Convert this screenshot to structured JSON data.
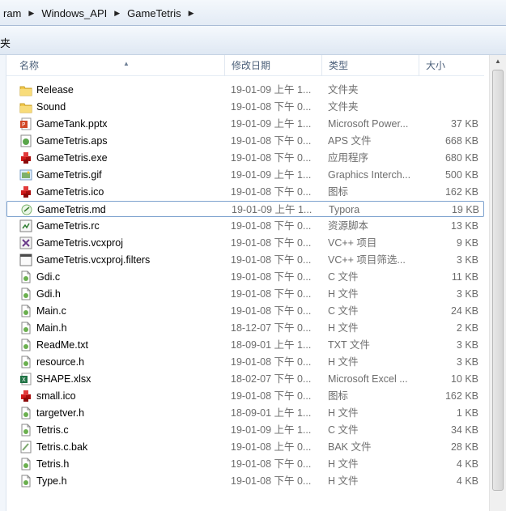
{
  "breadcrumb": [
    "ram",
    "Windows_API",
    "GameTetris"
  ],
  "toolbar": {
    "item_label": "夹"
  },
  "columns": {
    "name": "名称",
    "date": "修改日期",
    "type": "类型",
    "size": "大小"
  },
  "colors": {
    "selection_border": "#7da2ce",
    "header_text": "#4c607a",
    "meta_text": "#6d6d6d"
  },
  "files": [
    {
      "icon": "folder-icon",
      "name": "Release",
      "date": "19-01-09 上午 1...",
      "type": "文件夹",
      "size": ""
    },
    {
      "icon": "folder-icon",
      "name": "Sound",
      "date": "19-01-08 下午 0...",
      "type": "文件夹",
      "size": ""
    },
    {
      "icon": "pptx-icon",
      "name": "GameTank.pptx",
      "date": "19-01-09 上午 1...",
      "type": "Microsoft Power...",
      "size": "37 KB"
    },
    {
      "icon": "aps-icon",
      "name": "GameTetris.aps",
      "date": "19-01-08 下午 0...",
      "type": "APS 文件",
      "size": "668 KB"
    },
    {
      "icon": "exe-icon",
      "name": "GameTetris.exe",
      "date": "19-01-08 下午 0...",
      "type": "应用程序",
      "size": "680 KB"
    },
    {
      "icon": "gif-icon",
      "name": "GameTetris.gif",
      "date": "19-01-09 上午 1...",
      "type": "Graphics Interch...",
      "size": "500 KB"
    },
    {
      "icon": "ico-icon",
      "name": "GameTetris.ico",
      "date": "19-01-08 下午 0...",
      "type": "图标",
      "size": "162 KB"
    },
    {
      "icon": "md-icon",
      "name": "GameTetris.md",
      "date": "19-01-09 上午 1...",
      "type": "Typora",
      "size": "19 KB"
    },
    {
      "icon": "rc-icon",
      "name": "GameTetris.rc",
      "date": "19-01-08 下午 0...",
      "type": "资源脚本",
      "size": "13 KB"
    },
    {
      "icon": "vcxproj-icon",
      "name": "GameTetris.vcxproj",
      "date": "19-01-08 下午 0...",
      "type": "VC++ 项目",
      "size": "9 KB"
    },
    {
      "icon": "filters-icon",
      "name": "GameTetris.vcxproj.filters",
      "date": "19-01-08 下午 0...",
      "type": "VC++ 项目筛选...",
      "size": "3 KB"
    },
    {
      "icon": "c-file-icon",
      "name": "Gdi.c",
      "date": "19-01-08 下午 0...",
      "type": "C 文件",
      "size": "11 KB"
    },
    {
      "icon": "h-file-icon",
      "name": "Gdi.h",
      "date": "19-01-08 下午 0...",
      "type": "H 文件",
      "size": "3 KB"
    },
    {
      "icon": "c-file-icon",
      "name": "Main.c",
      "date": "19-01-08 下午 0...",
      "type": "C 文件",
      "size": "24 KB"
    },
    {
      "icon": "h-file-icon",
      "name": "Main.h",
      "date": "18-12-07 下午 0...",
      "type": "H 文件",
      "size": "2 KB"
    },
    {
      "icon": "txt-icon",
      "name": "ReadMe.txt",
      "date": "18-09-01 上午 1...",
      "type": "TXT 文件",
      "size": "3 KB"
    },
    {
      "icon": "h-file-icon",
      "name": "resource.h",
      "date": "19-01-08 下午 0...",
      "type": "H 文件",
      "size": "3 KB"
    },
    {
      "icon": "xlsx-icon",
      "name": "SHAPE.xlsx",
      "date": "18-02-07 下午 0...",
      "type": "Microsoft Excel ...",
      "size": "10 KB"
    },
    {
      "icon": "ico-icon",
      "name": "small.ico",
      "date": "19-01-08 下午 0...",
      "type": "图标",
      "size": "162 KB"
    },
    {
      "icon": "h-file-icon",
      "name": "targetver.h",
      "date": "18-09-01 上午 1...",
      "type": "H 文件",
      "size": "1 KB"
    },
    {
      "icon": "c-file-icon",
      "name": "Tetris.c",
      "date": "19-01-09 上午 1...",
      "type": "C 文件",
      "size": "34 KB"
    },
    {
      "icon": "bak-icon",
      "name": "Tetris.c.bak",
      "date": "19-01-08 上午 0...",
      "type": "BAK 文件",
      "size": "28 KB"
    },
    {
      "icon": "h-file-icon",
      "name": "Tetris.h",
      "date": "19-01-08 下午 0...",
      "type": "H 文件",
      "size": "4 KB"
    },
    {
      "icon": "h-file-icon",
      "name": "Type.h",
      "date": "19-01-08 下午 0...",
      "type": "H 文件",
      "size": "4 KB"
    }
  ],
  "selected_name": "GameTetris.md"
}
